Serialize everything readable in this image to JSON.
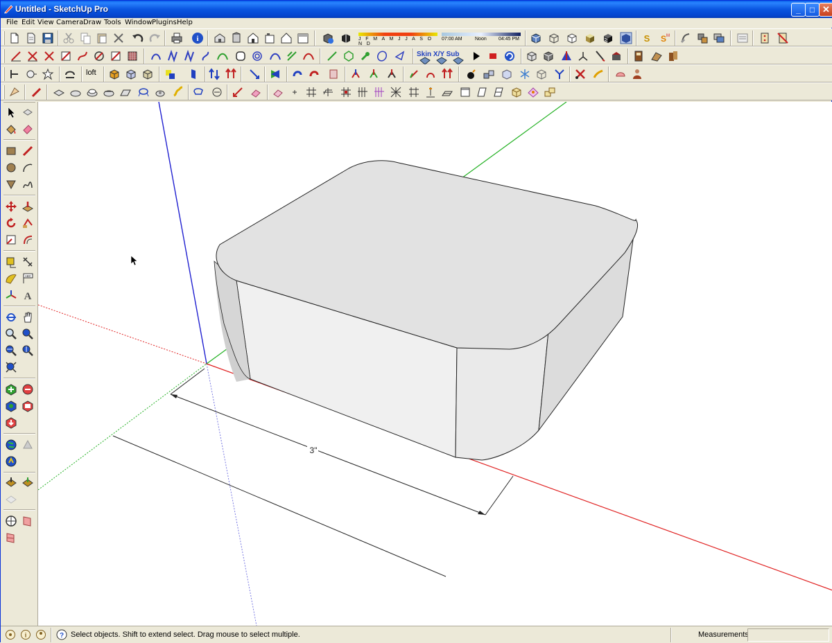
{
  "window": {
    "title": "Untitled - SketchUp Pro"
  },
  "menu": {
    "items": [
      "File",
      "Edit",
      "View",
      "Camera",
      "Draw",
      "Tools",
      "Window",
      "Plugins",
      "Help"
    ]
  },
  "toolbar": {
    "shadow_months": "J F M A M J J A S O N D",
    "time_start": "07:00 AM",
    "time_noon": "Noon",
    "time_end": "04:45 PM",
    "loft_label": "loft",
    "subd_label": "Skin X/Y Sub",
    "icons_row1": [
      "new-icon",
      "open-icon",
      "save-icon",
      "cut-icon",
      "copy-icon",
      "paste-icon",
      "erase-icon",
      "undo-icon",
      "redo-icon",
      "print-icon",
      "model-info-icon",
      "iso-view-icon",
      "top-view-icon",
      "front-view-icon",
      "right-view-icon",
      "back-view-icon",
      "left-view-icon",
      "shadow-settings-icon",
      "shadows-toggle-icon",
      "xray-icon",
      "wireframe-icon",
      "hidden-line-icon",
      "shaded-icon",
      "shaded-textures-icon",
      "monochrome-icon",
      "plugin-s-icon",
      "plugin-m-icon",
      "sandbox-icon",
      "plugin-icon",
      "components-icon",
      "layers-icon",
      "dynamic-icon",
      "fredo-icon"
    ],
    "icons_row2": [
      "line-tool-icon",
      "bezier-icon",
      "arc-icon",
      "polyline-icon",
      "spline-icon",
      "curve-icon",
      "polygon-icon",
      "spiral-icon",
      "circle-icon",
      "skin-icon",
      "play-icon",
      "stop-icon",
      "refresh-icon",
      "solid-icon",
      "box-icon",
      "cone-icon",
      "axis-icon",
      "pen-icon",
      "tape-icon",
      "piano-icon",
      "tools-icon"
    ],
    "icons_row3": [
      "push-pull-icon",
      "sphere-icon",
      "star-icon",
      "sweep-icon",
      "loft-icon",
      "cube-icon",
      "cube2-icon",
      "material-icon",
      "flip-icon",
      "align-icon",
      "mirror-icon",
      "rotate-icon",
      "scale-icon",
      "extrude-icon",
      "joint-icon",
      "bomb-icon",
      "blocks-icon",
      "snowflake-icon",
      "y-icon",
      "scissor-icon",
      "duck-icon",
      "shell-icon"
    ],
    "icons_row4": [
      "cone-tool-icon",
      "pencil-icon",
      "group-icon",
      "intersect-icon",
      "layers2-icon",
      "section-icon",
      "lasso-icon",
      "gear-icon",
      "grid-icon",
      "stairs-icon",
      "window-icon",
      "frame-icon",
      "roof-icon"
    ]
  },
  "left_tools": [
    "select-icon",
    "eraser-icon",
    "paint-bucket-icon",
    "eraser2-icon",
    "rectangle-icon",
    "pencil-icon",
    "circle-icon",
    "arc-icon",
    "polygon-icon",
    "freehand-icon",
    "move-icon",
    "push-pull-icon",
    "rotate-icon",
    "follow-me-icon",
    "scale-icon",
    "offset-icon",
    "tape-measure-icon",
    "dimension-icon",
    "protractor-icon",
    "text-icon",
    "axes-icon",
    "3d-text-icon",
    "orbit-icon",
    "pan-icon",
    "zoom-icon",
    "zoom-window-icon",
    "previous-view-icon",
    "next-view-icon",
    "zoom-extents-icon",
    "add-location-icon",
    "toggle-terrain-icon",
    "preview-earth-icon",
    "get-models-icon",
    "share-model-icon",
    "share-component-icon",
    "position-camera-icon",
    "walk-icon",
    "look-around-icon",
    "section-plane-icon",
    "section-display-icon"
  ],
  "viewport": {
    "dimension_label": "3\"",
    "colors": {
      "red_axis": "#e02020",
      "green_axis": "#20b020",
      "blue_axis": "#2020d0",
      "top_face": "#e4e4e4",
      "front_face": "#efefef",
      "right_face": "#d8d8d8"
    }
  },
  "status": {
    "message": "Select objects. Shift to extend select. Drag mouse to select multiple.",
    "measurements_label": "Measurements",
    "measurements_value": ""
  }
}
